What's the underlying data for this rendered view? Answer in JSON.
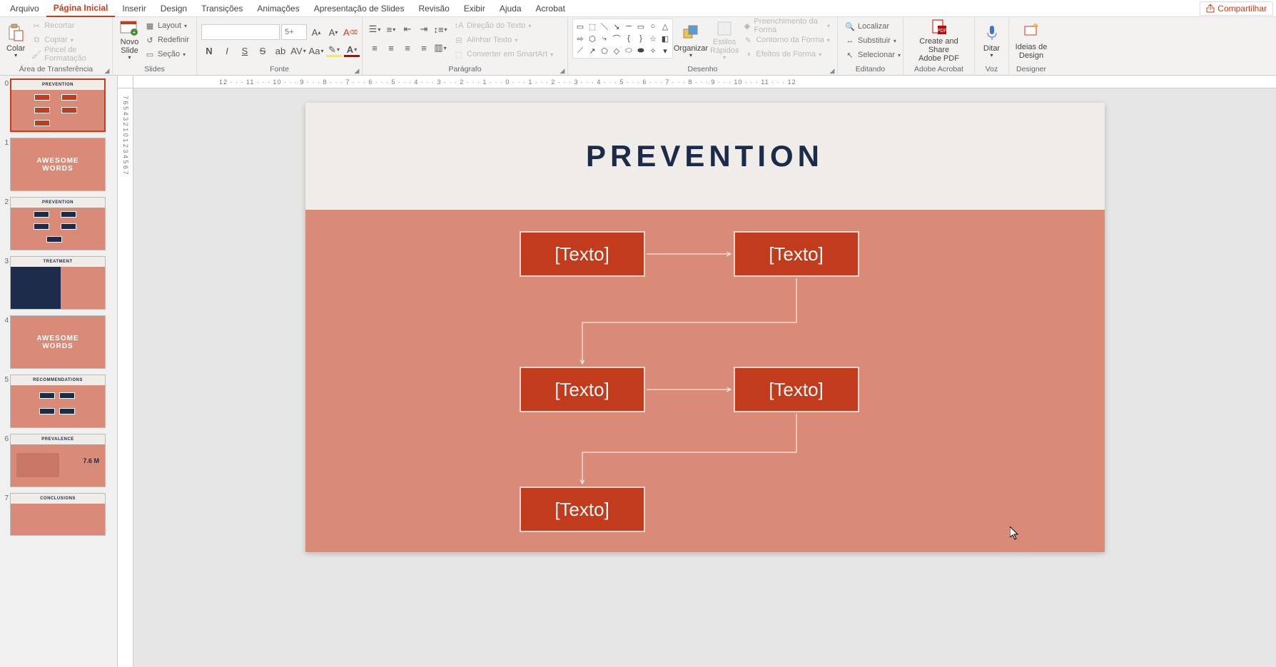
{
  "menubar": {
    "tabs": [
      "Arquivo",
      "Página Inicial",
      "Inserir",
      "Design",
      "Transições",
      "Animações",
      "Apresentação de Slides",
      "Revisão",
      "Exibir",
      "Ajuda",
      "Acrobat"
    ],
    "active_index": 1,
    "share": "Compartilhar"
  },
  "ribbon": {
    "clipboard": {
      "paste": "Colar",
      "cut": "Recortar",
      "copy": "Copiar",
      "format_painter": "Pincel de Formatação",
      "label": "Área de Transferência"
    },
    "slides": {
      "new_slide": "Novo\nSlide",
      "layout": "Layout",
      "reset": "Redefinir",
      "section": "Seção",
      "label": "Slides"
    },
    "font": {
      "name": "",
      "size": "",
      "size_placeholder": "5+",
      "label": "Fonte"
    },
    "paragraph": {
      "text_direction": "Direção do Texto",
      "align_text": "Alinhar Texto",
      "convert_smartart": "Converter em SmartArt",
      "label": "Parágrafo"
    },
    "drawing": {
      "arrange": "Organizar",
      "quick_styles": "Estilos\nRápidos",
      "shape_fill": "Preenchimento da Forma",
      "shape_outline": "Contorno da Forma",
      "shape_effects": "Efeitos de Forma",
      "label": "Desenho"
    },
    "editing": {
      "find": "Localizar",
      "replace": "Substituir",
      "select": "Selecionar",
      "label": "Editando"
    },
    "acrobat": {
      "create_share": "Create and Share\nAdobe PDF",
      "label": "Adobe Acrobat"
    },
    "voice": {
      "dictate": "Ditar",
      "label": "Voz"
    },
    "designer": {
      "ideas": "Ideias de\nDesign",
      "label": "Designer"
    }
  },
  "ruler_h": "12 · · · 11 · · · 10 · · · 9 · · · 8 · · · 7 · · · 6 · · · 5 · · · 4 · · · 3 · · · 2 · · · 1 · · · 0 · · · 1 · · · 2 · · · 3 · · · 4 · · · 5 · · · 6 · · · 7 · · · 8 · · · 9 · · · 10 · · · 11 · · · 12",
  "ruler_v": [
    "7",
    "6",
    "5",
    "4",
    "3",
    "2",
    "1",
    "0",
    "1",
    "2",
    "3",
    "4",
    "5",
    "6",
    "7"
  ],
  "thumbs": [
    {
      "num": "0",
      "type": "prevention-flow",
      "title": "PREVENTION"
    },
    {
      "num": "1",
      "type": "words",
      "text": "AWESOME\nWORDS"
    },
    {
      "num": "2",
      "type": "prevention-steps",
      "title": "PREVENTION"
    },
    {
      "num": "3",
      "type": "treatment",
      "title": "TREATMENT"
    },
    {
      "num": "4",
      "type": "words-photo",
      "text": "AWESOME\nWORDS"
    },
    {
      "num": "5",
      "type": "recommendations",
      "title": "RECOMMENDATIONS"
    },
    {
      "num": "6",
      "type": "prevalence",
      "title": "PREVALENCE",
      "stat": "7.6 M"
    },
    {
      "num": "7",
      "type": "conclusions",
      "title": "CONCLUSIONS"
    }
  ],
  "slide": {
    "title": "PREVENTION",
    "boxes": [
      "[Texto]",
      "[Texto]",
      "[Texto]",
      "[Texto]",
      "[Texto]"
    ]
  }
}
